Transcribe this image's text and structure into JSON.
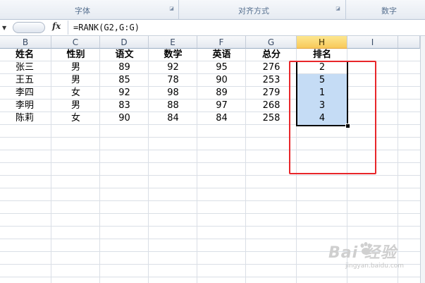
{
  "ribbon": {
    "groups": [
      {
        "label": "字体"
      },
      {
        "label": "对齐方式"
      },
      {
        "label": "数字"
      }
    ]
  },
  "formula_bar": {
    "fx_label": "fx",
    "formula": "=RANK(G2,G:G)"
  },
  "columns": [
    "B",
    "C",
    "D",
    "E",
    "F",
    "G",
    "H",
    "I"
  ],
  "selected_column": "H",
  "sheet": {
    "header": [
      "姓名",
      "性别",
      "语文",
      "数学",
      "英语",
      "总分",
      "排名"
    ],
    "rows": [
      [
        "张三",
        "男",
        "89",
        "92",
        "95",
        "276",
        "2"
      ],
      [
        "王五",
        "男",
        "85",
        "78",
        "90",
        "253",
        "5"
      ],
      [
        "李四",
        "女",
        "92",
        "98",
        "89",
        "279",
        "1"
      ],
      [
        "李明",
        "男",
        "83",
        "88",
        "97",
        "268",
        "3"
      ],
      [
        "陈莉",
        "女",
        "90",
        "84",
        "84",
        "258",
        "4"
      ]
    ]
  },
  "watermark": {
    "brand": "Bai 经验",
    "site": "jingyan.baidu.com"
  },
  "colors": {
    "highlight_box": "#e8262a",
    "selection_fill": "#c5dcf5",
    "selected_header": "#f8c95a"
  }
}
